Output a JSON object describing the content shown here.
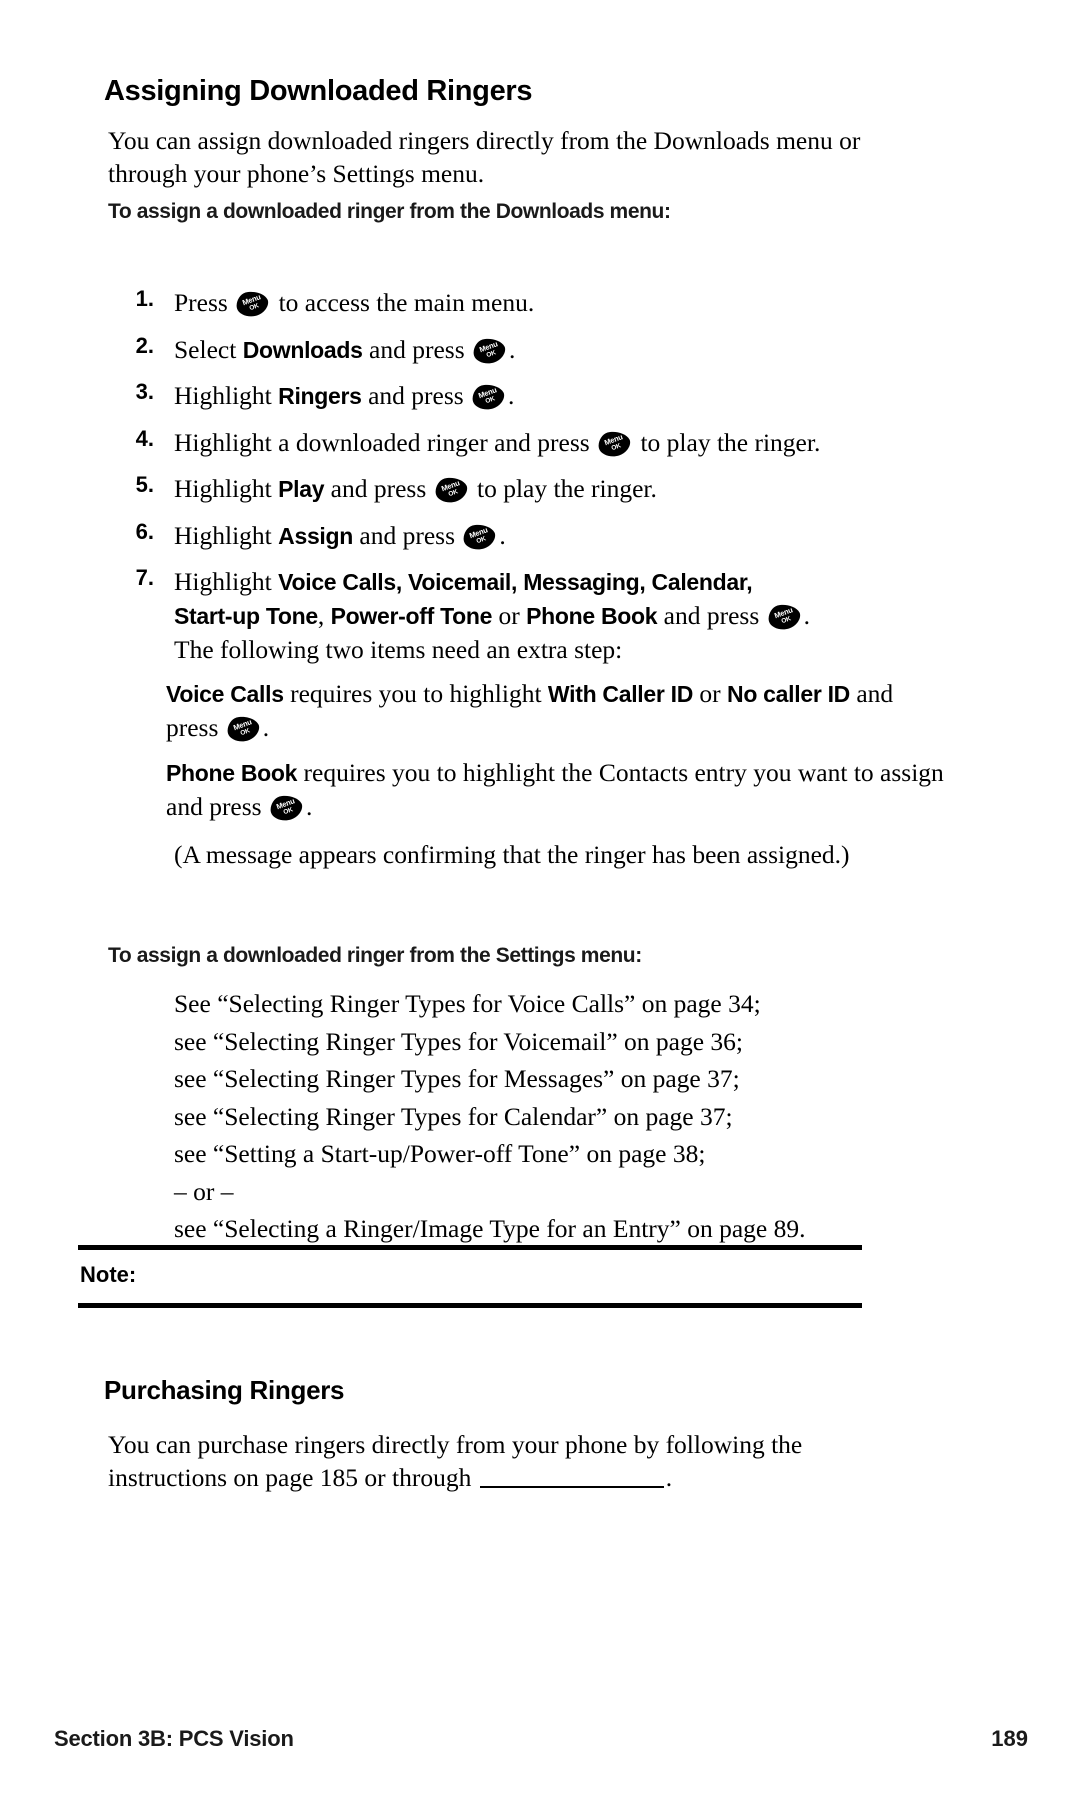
{
  "page": {
    "number": "189",
    "section_footer": "Section 3B: PCS Vision"
  },
  "heading": {
    "title": "Assigning Downloaded Ringers"
  },
  "intro": {
    "paragraph": "You can assign downloaded ringers directly from the Downloads menu or through your phone’s Settings menu."
  },
  "downloads_procedure": {
    "subheading": "To assign a downloaded ringer from the Downloads menu:",
    "steps": [
      {
        "number": "1.",
        "pre": "Press ",
        "icon": "menu-ok-key-icon",
        "post": " to access the main menu."
      },
      {
        "number": "2.",
        "pre": "Select ",
        "bold": "Downloads",
        "mid": " and press ",
        "icon": "menu-ok-key-icon",
        "post": "."
      },
      {
        "number": "3.",
        "pre": "Highlight ",
        "bold": "Ringers",
        "mid": " and press ",
        "icon": "menu-ok-key-icon",
        "post": "."
      },
      {
        "number": "4.",
        "pre": "Highlight a downloaded ringer and press ",
        "icon": "menu-ok-key-icon",
        "post": " to play the ringer."
      },
      {
        "number": "5.",
        "pre": "Highlight ",
        "bold": "Play",
        "mid": " and press ",
        "icon": "menu-ok-key-icon",
        "post": " to play the ringer."
      },
      {
        "number": "6.",
        "pre": "Highlight ",
        "bold": "Assign",
        "mid": " and press ",
        "icon": "menu-ok-key-icon",
        "post": "."
      }
    ],
    "step7": {
      "number": "7.",
      "lead": "Highlight ",
      "options_line1": "Voice Calls, Voicemail, Messaging, Calendar,",
      "options_line2_a": "Start-up Tone",
      "options_line2_comma": ", ",
      "options_line2_b": "Power-off Tone",
      "options_line2_or": " or ",
      "options_line2_c": "Phone Book",
      "options_line2_tail": " and press ",
      "icon": "menu-ok-key-icon",
      "options_line2_end": ".",
      "extra_step_note": "The following two items need an extra step:",
      "sub_items": [
        {
          "bold_lead": "Voice Calls",
          "text_a": " requires you to highlight ",
          "bold_mid": "With Caller ID",
          "text_b": " or ",
          "bold_end": "No caller ID",
          "text_c": " and press ",
          "icon": "menu-ok-key-icon",
          "text_d": "."
        },
        {
          "bold_lead": "Phone Book",
          "text_a": " requires you to highlight the Contacts entry you want to assign and press ",
          "icon": "menu-ok-key-icon",
          "text_d": "."
        }
      ],
      "confirmation": "(A message appears confirming that the ringer has been assigned.)"
    }
  },
  "settings_procedure": {
    "subheading": "To assign a downloaded ringer from the Settings menu:",
    "references": [
      "See “Selecting Ringer Types for Voice Calls” on page 34;",
      "see “Selecting Ringer Types for Voicemail” on page 36;",
      "see “Selecting Ringer Types for Messages” on page 37;",
      "see “Selecting Ringer Types for Calendar” on page 37;",
      "see “Setting a Start-up/Power-off Tone” on page 38;",
      "– or –",
      "see “Selecting a Ringer/Image Type for an Entry” on page 89."
    ]
  },
  "note_box": {
    "label": "Note:",
    "text": ""
  },
  "purchasing": {
    "heading": "Purchasing Ringers",
    "paragraph_a": "You can purchase ringers directly from your phone by following the instructions on page 185 or through ",
    "blank": "",
    "paragraph_b": "."
  },
  "colors": {
    "text": "#000000",
    "heading": "#000000",
    "rule": "#000000",
    "footer": "#1a1a1a"
  }
}
